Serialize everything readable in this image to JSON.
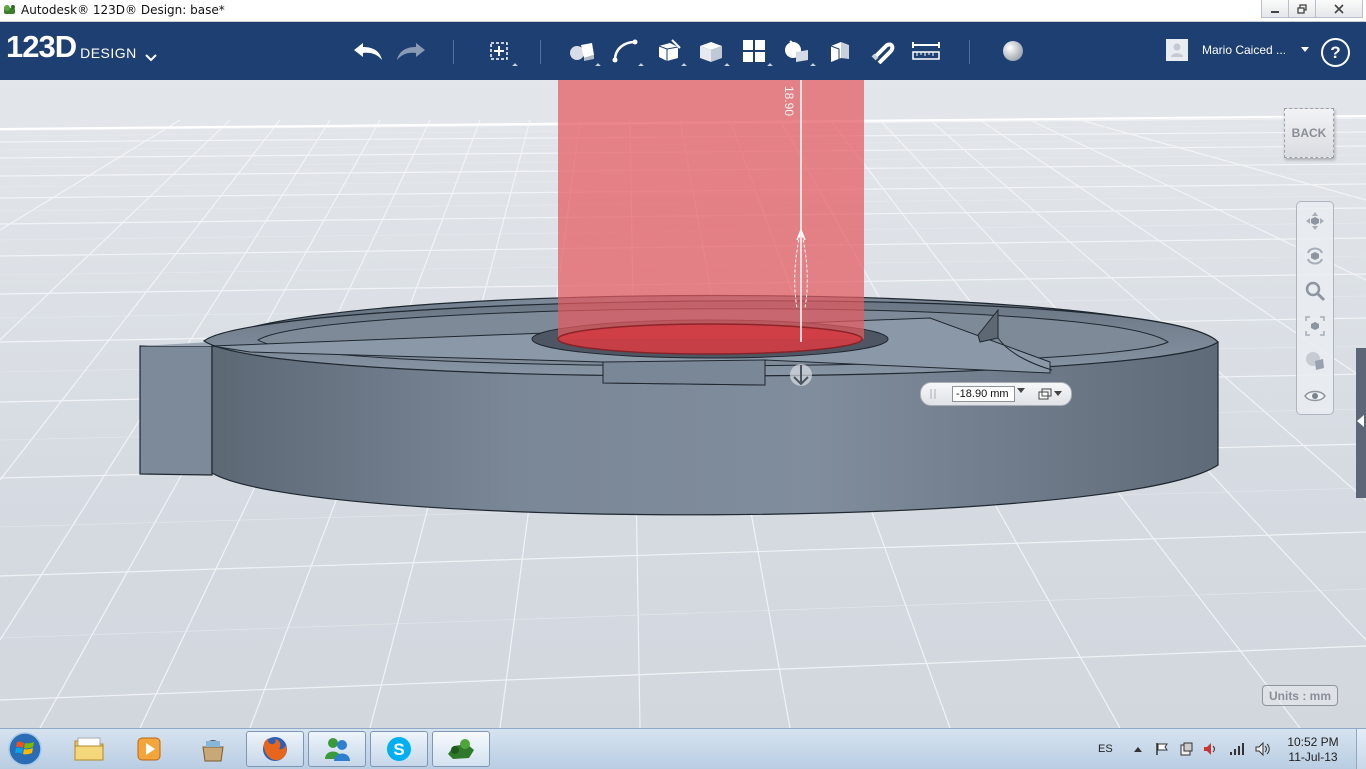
{
  "window": {
    "title": "Autodesk® 123D® Design: base*",
    "controls": [
      "minimize",
      "restore",
      "close"
    ]
  },
  "app": {
    "logo_number": "123D",
    "logo_word": "DESIGN"
  },
  "toolbar": {
    "tools": [
      "undo",
      "redo",
      "transform",
      "primitives",
      "sketch",
      "construct",
      "modify",
      "pattern",
      "grouping",
      "combine",
      "snap",
      "measure",
      "material"
    ]
  },
  "user": {
    "name": "Mario Caiced ...",
    "help": "?"
  },
  "viewport": {
    "back_label": "BACK",
    "units_label": "Units : mm",
    "dimension_label": "18.90",
    "extrude_value": "-18.90 mm",
    "navigation": [
      "pan",
      "orbit",
      "zoom",
      "fit",
      "view",
      "visibility"
    ]
  },
  "taskbar": {
    "apps": [
      "Windows Explorer",
      "Media Player",
      "Shopping Bag",
      "Firefox",
      "Messenger",
      "Skype",
      "123D Design"
    ],
    "language": "ES",
    "time": "10:52 PM",
    "date": "11-Jul-13"
  }
}
